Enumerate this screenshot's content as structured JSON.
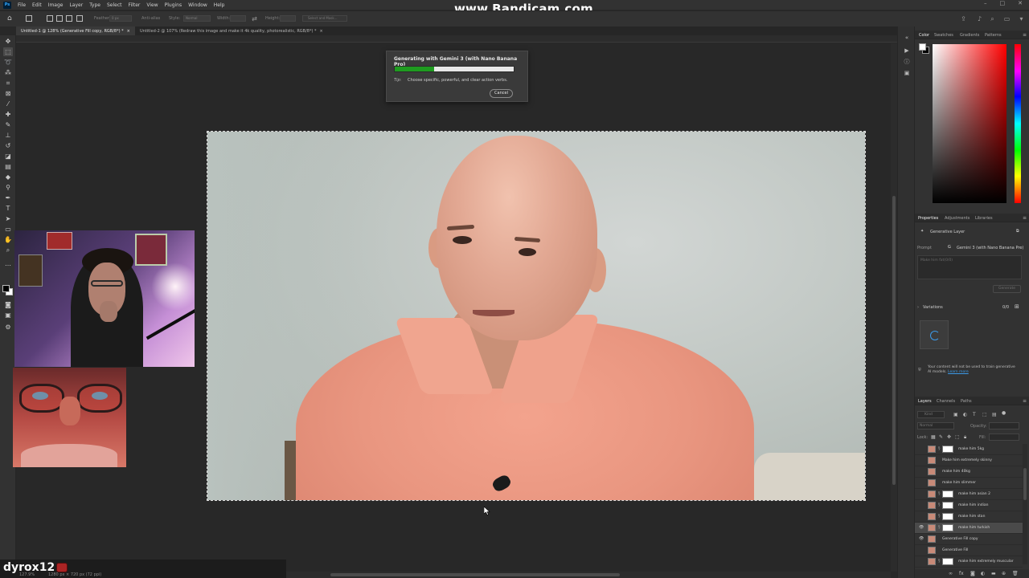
{
  "watermark": "www.Bandicam.com",
  "menu": [
    "File",
    "Edit",
    "Image",
    "Layer",
    "Type",
    "Select",
    "Filter",
    "View",
    "Plugins",
    "Window",
    "Help"
  ],
  "ps_logo": "Ps",
  "options": {
    "feather_label": "Feather:",
    "feather_value": "0 px",
    "antialias_label": "Anti-alias",
    "style_label": "Style:",
    "style_value": "Normal",
    "width_label": "Width:",
    "height_label": "Height:",
    "select_mask_label": "Select and Mask..."
  },
  "tabs": [
    {
      "label": "Untitled-1 @ 128% (Generative Fill copy, RGB/8*) *",
      "active": true
    },
    {
      "label": "Untitled-2 @ 107% (Redraw this image and make it 4k quality, photorealistic, RGB/8*) *",
      "active": false
    }
  ],
  "progress": {
    "title": "Generating with Gemini 3 (with Nano Banana Pro)",
    "percent": 0.33,
    "tip_label": "Tip:",
    "tip_text": "Choose specific, powerful, and clear action verbs.",
    "cancel": "Cancel"
  },
  "chat": {
    "user": "dyrox12 :"
  },
  "status": {
    "zoom": "127.9%",
    "doc": "1280 px × 720 px (72 ppi)"
  },
  "color_panel": {
    "tabs": [
      "Color",
      "Swatches",
      "Gradients",
      "Patterns"
    ]
  },
  "properties_panel": {
    "tabs": [
      "Properties",
      "Adjustments",
      "Libraries"
    ],
    "layer_type": "Generative Layer",
    "prompt_label": "Prompt",
    "model": "Gemini 3 (with Nano Banana Pro)",
    "prompt_placeholder": "Make him fat(0/0)",
    "generate": "Generate",
    "variations_label": "Variations",
    "variations_count": "0/0",
    "notice": "Your content will not be used to train generative AI models.",
    "learn_more": "Learn more"
  },
  "layers_panel": {
    "tabs": [
      "Layers",
      "Channels",
      "Paths"
    ],
    "kind_label": "Kind",
    "blend_mode": "Normal",
    "opacity_label": "Opacity:",
    "lock_label": "Lock:",
    "fill_label": "Fill:",
    "layers": [
      {
        "name": "make him 5kg",
        "visible": false,
        "selected": false,
        "mask": true
      },
      {
        "name": "Make him extremely skinny",
        "visible": false,
        "selected": false,
        "mask": false
      },
      {
        "name": "make him 40kg",
        "visible": false,
        "selected": false,
        "mask": false
      },
      {
        "name": "make him slimmer",
        "visible": false,
        "selected": false,
        "mask": false
      },
      {
        "name": "make him asian 2",
        "visible": false,
        "selected": false,
        "mask": true
      },
      {
        "name": "make him indian",
        "visible": false,
        "selected": false,
        "mask": true
      },
      {
        "name": "make him stan",
        "visible": false,
        "selected": false,
        "mask": true
      },
      {
        "name": "make him turkish",
        "visible": true,
        "selected": true,
        "mask": true
      },
      {
        "name": "Generative Fill copy",
        "visible": true,
        "selected": false,
        "mask": false
      },
      {
        "name": "Generative Fill",
        "visible": false,
        "selected": false,
        "mask": false
      },
      {
        "name": "make him extremely muscular",
        "visible": false,
        "selected": false,
        "mask": true
      }
    ]
  }
}
